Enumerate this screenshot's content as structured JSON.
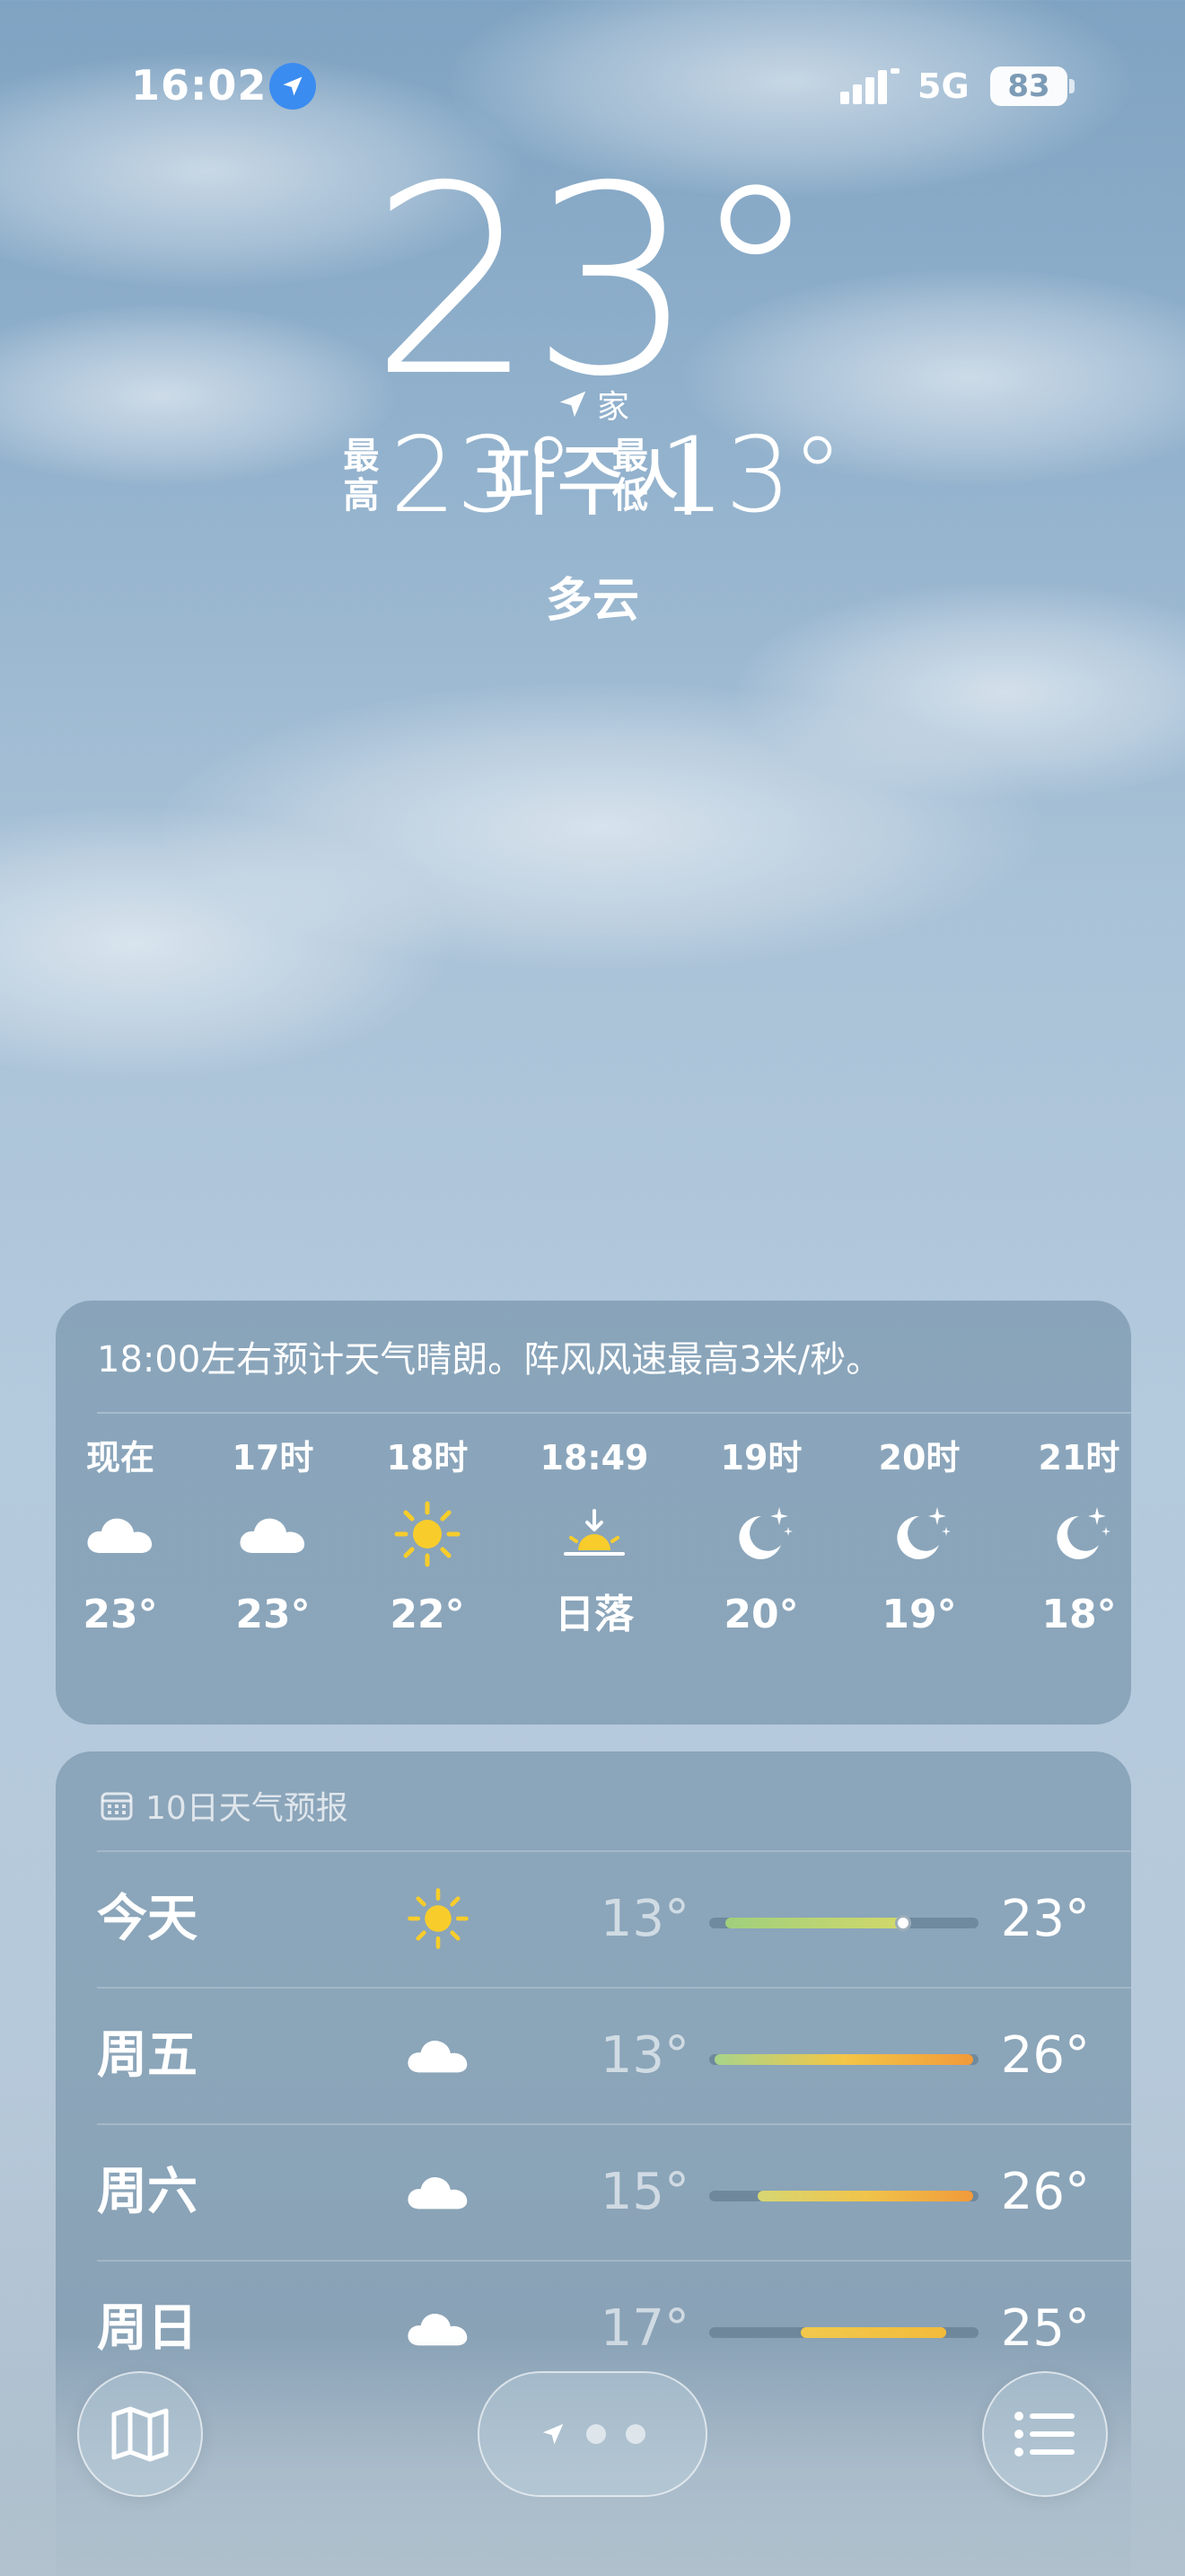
{
  "status_bar": {
    "time": "16:02",
    "network": "5G",
    "battery": "83"
  },
  "location": {
    "label": "家",
    "city": "파주시"
  },
  "current": {
    "temperature": "23°",
    "high_label": "最高",
    "high": "23°",
    "low_label": "最低",
    "low": "13°",
    "condition": "多云"
  },
  "hourly": {
    "summary": "18:00左右预计天气晴朗。阵风风速最高3米/秒。",
    "items": [
      {
        "label": "现在",
        "icon": "cloud-icon",
        "temp": "23°"
      },
      {
        "label": "17时",
        "icon": "cloud-icon",
        "temp": "23°"
      },
      {
        "label": "18时",
        "icon": "sun-icon",
        "temp": "22°"
      },
      {
        "label": "18:49",
        "icon": "sunset-icon",
        "temp": "日落"
      },
      {
        "label": "19时",
        "icon": "moon-stars-icon",
        "temp": "20°"
      },
      {
        "label": "20时",
        "icon": "moon-stars-icon",
        "temp": "19°"
      },
      {
        "label": "21时",
        "icon": "moon-stars-icon",
        "temp": "18°"
      }
    ]
  },
  "daily": {
    "title": "10日天气预报",
    "items": [
      {
        "day": "今天",
        "icon": "sun-icon",
        "low": "13°",
        "high": "23°",
        "range_start": 0.06,
        "range_end": 0.72,
        "current": 0.72,
        "gradient": [
          "#9fd07d",
          "#d2d86a"
        ]
      },
      {
        "day": "周五",
        "icon": "cloud-icon",
        "low": "13°",
        "high": "26°",
        "range_start": 0.02,
        "range_end": 0.98,
        "gradient": [
          "#a8d48a",
          "#f3c646",
          "#f19a3a"
        ]
      },
      {
        "day": "周六",
        "icon": "cloud-icon",
        "low": "15°",
        "high": "26°",
        "range_start": 0.18,
        "range_end": 0.98,
        "gradient": [
          "#d7d772",
          "#f1c44a",
          "#f19a3a"
        ]
      },
      {
        "day": "周日",
        "icon": "cloud-icon",
        "low": "17°",
        "high": "25°",
        "range_start": 0.34,
        "range_end": 0.88,
        "gradient": [
          "#f1c94c",
          "#f3bb3a"
        ]
      }
    ]
  },
  "nav": {
    "map": "map-icon",
    "location": "location-arrow-icon",
    "list": "list-icon"
  },
  "colors": {
    "sun": "#f8cd2b",
    "location_blue": "#3b8cf0"
  }
}
